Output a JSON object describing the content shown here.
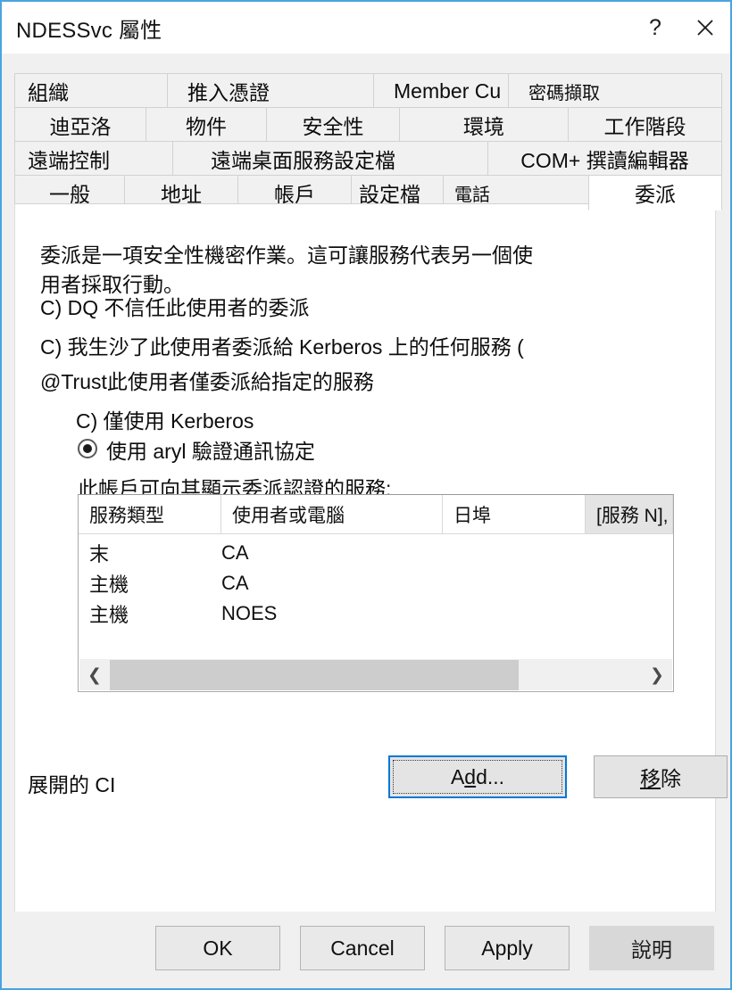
{
  "window": {
    "title": "NDESSvc 屬性",
    "help_icon": "question-mark-icon",
    "close_icon": "close-x-icon",
    "accent": "#4aa3e0"
  },
  "tabs": {
    "row1": [
      {
        "label": "組織"
      },
      {
        "label": "推入憑證"
      },
      {
        "label": "Member Cu"
      },
      {
        "label": "密碼擷取"
      }
    ],
    "row2": [
      {
        "label": "迪亞洛"
      },
      {
        "label": "物件"
      },
      {
        "label": "安全性"
      },
      {
        "label": "環境"
      },
      {
        "label": "工作階段"
      }
    ],
    "row3": [
      {
        "label": "遠端控制"
      },
      {
        "label": "遠端桌面服務設定檔"
      },
      {
        "label": "COM+ 撰讀編輯器"
      }
    ],
    "row4": [
      {
        "label": "一般"
      },
      {
        "label": "地址"
      },
      {
        "label": "帳戶"
      },
      {
        "label": "設定檔"
      },
      {
        "label": "電話"
      },
      {
        "label": "委派"
      }
    ],
    "selected": "委派"
  },
  "content": {
    "description_line1": "委派是一項安全性機密作業。這可讓服務代表另一個使",
    "description_line2": "用者採取行動。",
    "option_no_delegation": "C) DQ 不信任此使用者的委派",
    "option_any_service": "C) 我生沙了此使用者委派給 Kerberos 上的任何服務 (",
    "option_specified": "@Trust此使用者僅委派給指定的服務",
    "sub_option_kerberos_only": "C) 僅使用 Kerberos",
    "sub_option_any_protocol": "使用 aryl 驗證通訊協定",
    "list_caption": "此帳戶可向其顯示委派認證的服務:"
  },
  "listview": {
    "columns": [
      {
        "label": "服務類型",
        "active": false
      },
      {
        "label": "使用者或電腦",
        "active": false
      },
      {
        "label": "日埠",
        "active": false
      },
      {
        "label": "[服務 N],",
        "active": true
      }
    ],
    "rows": [
      {
        "service_type": "末",
        "user_or_computer": "CA"
      },
      {
        "service_type": "主機",
        "user_or_computer": "CA"
      },
      {
        "service_type": "主機",
        "user_or_computer": "NOES"
      }
    ],
    "scroll_left_icon": "chevron-left-icon",
    "scroll_right_icon": "chevron-right-icon"
  },
  "actions": {
    "expand_label": "展開的 CI",
    "add_button": "Add...",
    "add_button_pre": "A",
    "add_button_accel": "d",
    "add_button_post": "d...",
    "remove_button_accel": "移",
    "remove_button_post": "除"
  },
  "footer": {
    "ok": "OK",
    "cancel": "Cancel",
    "apply_accel": "A",
    "apply_post": "pply",
    "help": "說明"
  }
}
